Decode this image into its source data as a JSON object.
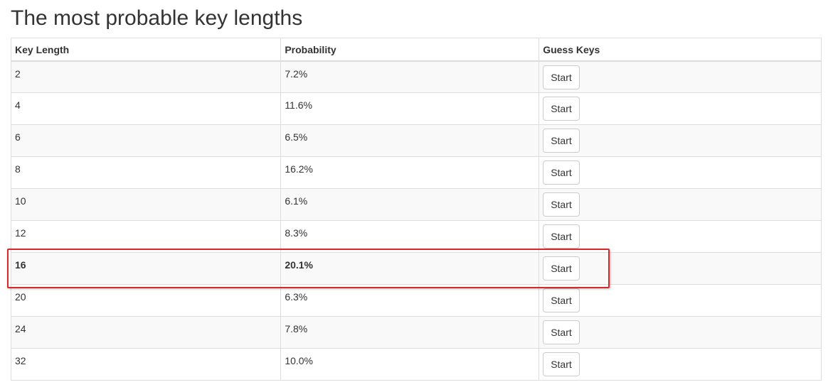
{
  "page": {
    "title": "The most probable key lengths"
  },
  "table": {
    "headers": {
      "key_length": "Key Length",
      "probability": "Probability",
      "guess_keys": "Guess Keys"
    },
    "button_label": "Start",
    "highlight_color": "#d9272e",
    "highlighted_key_length": "16",
    "rows": [
      {
        "key_length": "2",
        "probability": "7.2%",
        "action": "Start"
      },
      {
        "key_length": "4",
        "probability": "11.6%",
        "action": "Start"
      },
      {
        "key_length": "6",
        "probability": "6.5%",
        "action": "Start"
      },
      {
        "key_length": "8",
        "probability": "16.2%",
        "action": "Start"
      },
      {
        "key_length": "10",
        "probability": "6.1%",
        "action": "Start"
      },
      {
        "key_length": "12",
        "probability": "8.3%",
        "action": "Start"
      },
      {
        "key_length": "16",
        "probability": "20.1%",
        "action": "Start"
      },
      {
        "key_length": "20",
        "probability": "6.3%",
        "action": "Start"
      },
      {
        "key_length": "24",
        "probability": "7.8%",
        "action": "Start"
      },
      {
        "key_length": "32",
        "probability": "10.0%",
        "action": "Start"
      }
    ]
  }
}
